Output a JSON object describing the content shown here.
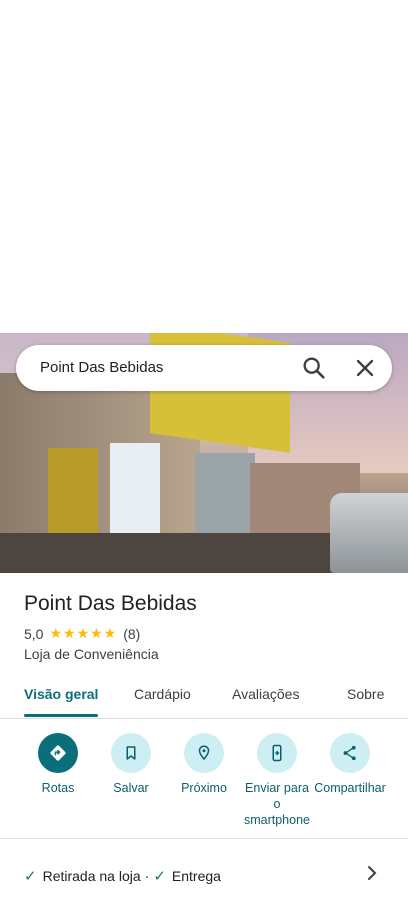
{
  "search": {
    "query": "Point Das Bebidas"
  },
  "place": {
    "name": "Point Das Bebidas",
    "rating": "5,0",
    "stars": "★★★★★",
    "reviews": "(8)",
    "category": "Loja de Conveniência"
  },
  "tabs": [
    {
      "label": "Visão geral",
      "active": true
    },
    {
      "label": "Cardápio"
    },
    {
      "label": "Avaliações"
    },
    {
      "label": "Sobre"
    }
  ],
  "actions": [
    {
      "label": "Rotas",
      "icon": "directions-icon"
    },
    {
      "label": "Salvar",
      "icon": "bookmark-icon"
    },
    {
      "label": "Próximo",
      "icon": "nearby-icon"
    },
    {
      "label": "Enviar para o smartphone",
      "icon": "send-to-phone-icon"
    },
    {
      "label": "Compartilhar",
      "icon": "share-icon"
    }
  ],
  "services": {
    "item1": "Retirada na loja",
    "separator": "·",
    "item2": "Entrega"
  },
  "colors": {
    "accent": "#0b6e7b",
    "chip": "#cdeff4",
    "star": "#fbbc04",
    "check": "#188038"
  }
}
